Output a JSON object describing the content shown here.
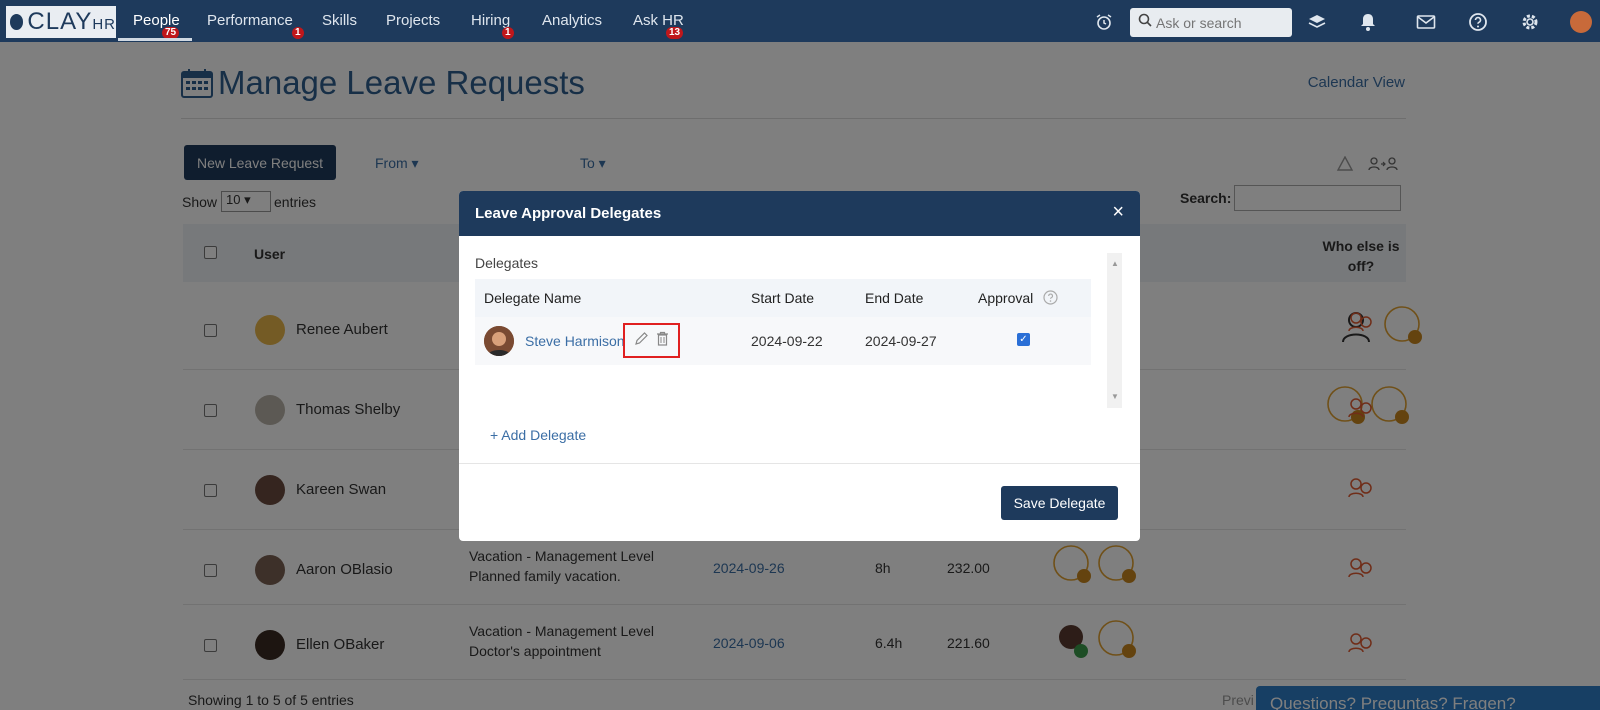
{
  "nav": {
    "logo_main": "CLAY",
    "logo_sub": "HR",
    "items": [
      {
        "label": "People",
        "badge": "75"
      },
      {
        "label": "Performance",
        "badge": "1"
      },
      {
        "label": "Skills",
        "badge": ""
      },
      {
        "label": "Projects",
        "badge": ""
      },
      {
        "label": "Hiring",
        "badge": "1"
      },
      {
        "label": "Analytics",
        "badge": ""
      },
      {
        "label": "Ask HR",
        "badge": "13"
      }
    ],
    "search_placeholder": "Ask or search"
  },
  "page": {
    "title": "Manage Leave Requests",
    "calendar_view": "Calendar View",
    "new_request": "New Leave Request",
    "from_label": "From",
    "to_label": "To",
    "show_label": "Show",
    "entries_value": "10",
    "entries_label": "entries",
    "search_label": "Search:",
    "col_user": "User",
    "col_who_else": "Who else is off?",
    "showing": "Showing 1 to 5 of 5 entries",
    "prev": "Previ",
    "help_banner": "Questions? Preguntas? Fragen?"
  },
  "rows": [
    {
      "user": "Renee Aubert",
      "type": "",
      "reason": "",
      "date": "",
      "hours": "",
      "balance": ""
    },
    {
      "user": "Thomas Shelby",
      "type": "",
      "reason": "",
      "date": "",
      "hours": "",
      "balance": ""
    },
    {
      "user": "Kareen Swan",
      "type": "",
      "reason": "",
      "date": "",
      "hours": "",
      "balance": ""
    },
    {
      "user": "Aaron OBlasio",
      "type": "Vacation - Management Level",
      "reason": "Planned family vacation.",
      "date": "2024-09-26",
      "hours": "8h",
      "balance": "232.00"
    },
    {
      "user": "Ellen OBaker",
      "type": "Vacation - Management Level",
      "reason": "Doctor's appointment",
      "date": "2024-09-06",
      "hours": "6.4h",
      "balance": "221.60"
    }
  ],
  "modal": {
    "title": "Leave Approval Delegates",
    "close": "×",
    "sub_heading": "Delegates",
    "col_name": "Delegate Name",
    "col_start": "Start Date",
    "col_end": "End Date",
    "col_approval": "Approval",
    "delegate": {
      "name": "Steve Harmison",
      "start": "2024-09-22",
      "end": "2024-09-27",
      "approval": true
    },
    "add_delegate": "+ Add Delegate",
    "save": "Save Delegate"
  }
}
